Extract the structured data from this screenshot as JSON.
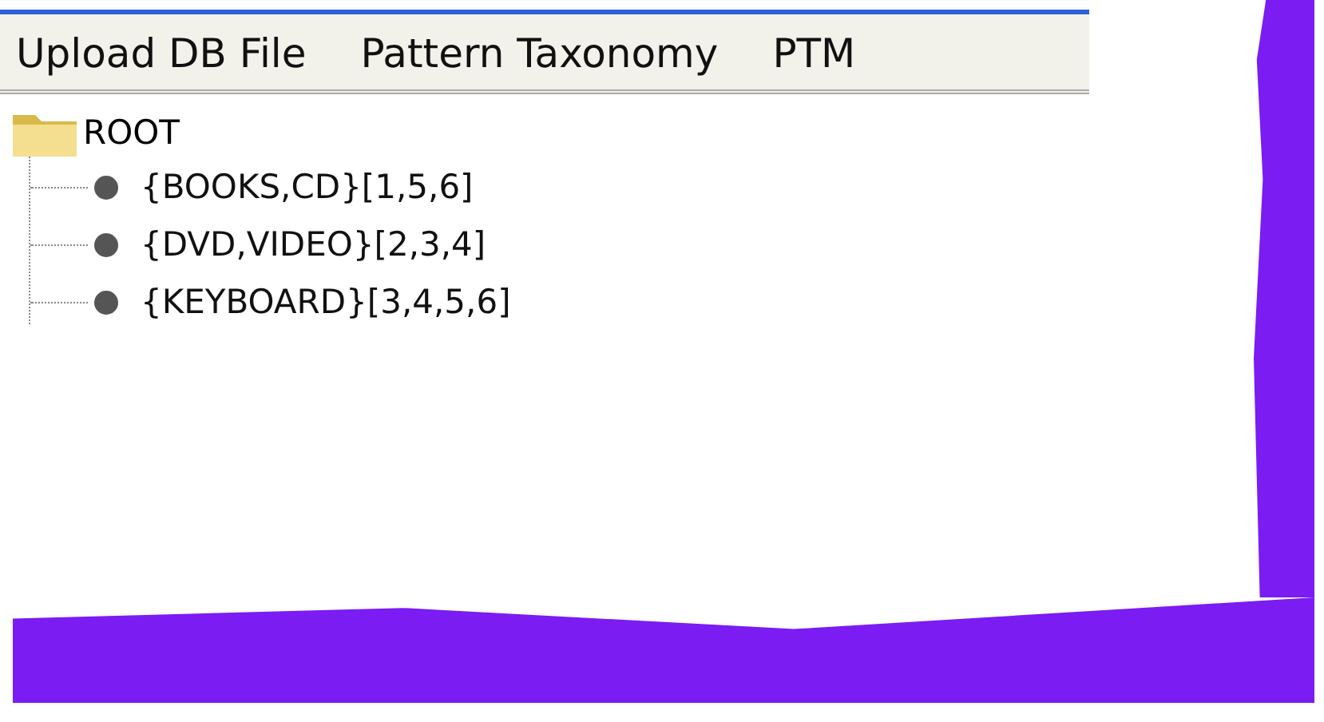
{
  "menu": [
    {
      "label": "Upload DB File"
    },
    {
      "label": "Pattern Taxonomy"
    },
    {
      "label": "PTM"
    }
  ],
  "tree": {
    "label": "ROOT",
    "children": [
      {
        "label": "{BOOKS,CD}[1,5,6]"
      },
      {
        "label": "{DVD,VIDEO}[2,3,4]"
      },
      {
        "label": "{KEYBOARD}[3,4,5,6]"
      }
    ]
  }
}
